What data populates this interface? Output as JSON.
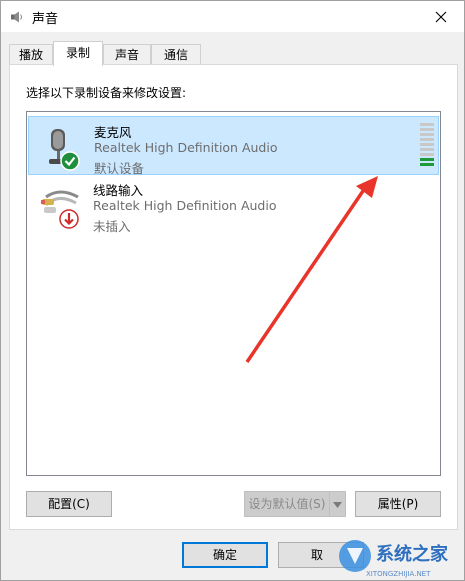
{
  "window": {
    "title": "声音",
    "title_icon": "speaker-icon",
    "close_icon": "close-icon"
  },
  "tabs": [
    {
      "label": "播放",
      "active": false
    },
    {
      "label": "录制",
      "active": true
    },
    {
      "label": "声音",
      "active": false
    },
    {
      "label": "通信",
      "active": false
    }
  ],
  "instruction": "选择以下录制设备来修改设置:",
  "devices": [
    {
      "name": "麦克风",
      "driver": "Realtek High Definition Audio",
      "status": "默认设备",
      "icon": "microphone-icon",
      "badge": "green-check-badge",
      "selected": true,
      "level_fraction": 0.1
    },
    {
      "name": "线路输入",
      "driver": "Realtek High Definition Audio",
      "status": "未插入",
      "icon": "line-in-cable-icon",
      "badge": "red-down-arrow-badge",
      "selected": false
    }
  ],
  "buttons": {
    "configure": "配置(C)",
    "set_default": "设为默认值(S)",
    "properties": "属性(P)",
    "ok": "确定",
    "cancel_partial": "取"
  },
  "annotation": {
    "color": "#e8342a"
  },
  "watermark": {
    "text": "系统之家",
    "url_text": "XITONGZHIJIA.NET"
  },
  "colors": {
    "selection": "#cce8ff",
    "accent": "#0078d7"
  }
}
